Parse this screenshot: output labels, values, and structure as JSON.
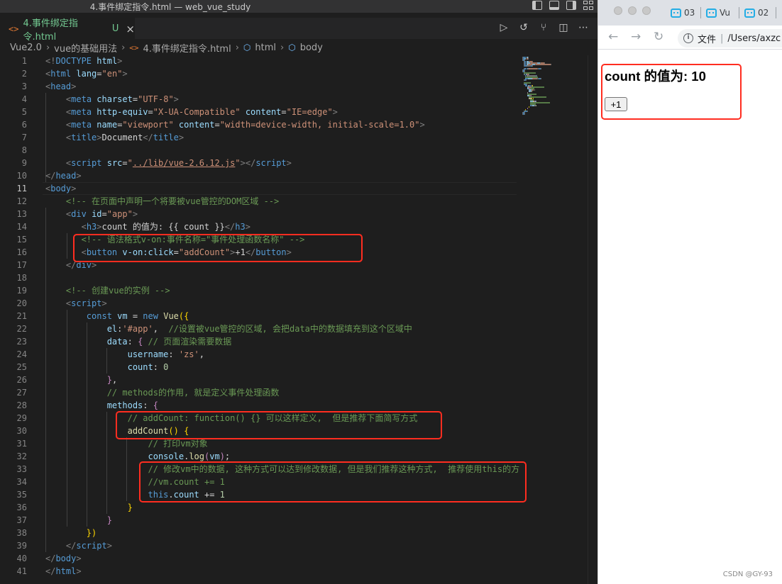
{
  "titlebar": {
    "title": "4.事件绑定指令.html — web_vue_study"
  },
  "tab": {
    "icon": "<>",
    "label": "4.事件绑定指令.html",
    "status": "U",
    "close": "×"
  },
  "breadcrumb": [
    "Vue2.0",
    "vue的基础用法",
    "4.事件绑定指令.html",
    "html",
    "body"
  ],
  "editor": {
    "current_line": 11,
    "lines": [
      {
        "n": 1,
        "code": [
          [
            "p",
            "<!"
          ],
          [
            "t",
            "DOCTYPE"
          ],
          [
            "w",
            " "
          ],
          [
            "a",
            "html"
          ],
          [
            "p",
            ">"
          ]
        ]
      },
      {
        "n": 2,
        "code": [
          [
            "p",
            "<"
          ],
          [
            "t",
            "html"
          ],
          [
            "w",
            " "
          ],
          [
            "a",
            "lang"
          ],
          [
            "w",
            "="
          ],
          [
            "s",
            "\"en\""
          ],
          [
            "p",
            ">"
          ]
        ]
      },
      {
        "n": 3,
        "code": [
          [
            "p",
            "<"
          ],
          [
            "t",
            "head"
          ],
          [
            "p",
            ">"
          ]
        ]
      },
      {
        "n": 4,
        "code": [
          [
            "w",
            "    "
          ],
          [
            "p",
            "<"
          ],
          [
            "t",
            "meta"
          ],
          [
            "w",
            " "
          ],
          [
            "a",
            "charset"
          ],
          [
            "w",
            "="
          ],
          [
            "s",
            "\"UTF-8\""
          ],
          [
            "p",
            ">"
          ]
        ]
      },
      {
        "n": 5,
        "code": [
          [
            "w",
            "    "
          ],
          [
            "p",
            "<"
          ],
          [
            "t",
            "meta"
          ],
          [
            "w",
            " "
          ],
          [
            "a",
            "http-equiv"
          ],
          [
            "w",
            "="
          ],
          [
            "s",
            "\"X-UA-Compatible\""
          ],
          [
            "w",
            " "
          ],
          [
            "a",
            "content"
          ],
          [
            "w",
            "="
          ],
          [
            "s",
            "\"IE=edge\""
          ],
          [
            "p",
            ">"
          ]
        ]
      },
      {
        "n": 6,
        "code": [
          [
            "w",
            "    "
          ],
          [
            "p",
            "<"
          ],
          [
            "t",
            "meta"
          ],
          [
            "w",
            " "
          ],
          [
            "a",
            "name"
          ],
          [
            "w",
            "="
          ],
          [
            "s",
            "\"viewport\""
          ],
          [
            "w",
            " "
          ],
          [
            "a",
            "content"
          ],
          [
            "w",
            "="
          ],
          [
            "s",
            "\"width=device-width, initial-scale=1.0\""
          ],
          [
            "p",
            ">"
          ]
        ]
      },
      {
        "n": 7,
        "code": [
          [
            "w",
            "    "
          ],
          [
            "p",
            "<"
          ],
          [
            "t",
            "title"
          ],
          [
            "p",
            ">"
          ],
          [
            "w",
            "Document"
          ],
          [
            "p",
            "</"
          ],
          [
            "t",
            "title"
          ],
          [
            "p",
            ">"
          ]
        ]
      },
      {
        "n": 8,
        "code": []
      },
      {
        "n": 9,
        "code": [
          [
            "w",
            "    "
          ],
          [
            "p",
            "<"
          ],
          [
            "t",
            "script"
          ],
          [
            "w",
            " "
          ],
          [
            "a",
            "src"
          ],
          [
            "w",
            "="
          ],
          [
            "s",
            "\""
          ],
          [
            "su",
            "../lib/vue-2.6.12.js"
          ],
          [
            "s",
            "\""
          ],
          [
            "p",
            "></"
          ],
          [
            "t",
            "script"
          ],
          [
            "p",
            ">"
          ]
        ]
      },
      {
        "n": 10,
        "code": [
          [
            "p",
            "</"
          ],
          [
            "t",
            "head"
          ],
          [
            "p",
            ">"
          ]
        ]
      },
      {
        "n": 11,
        "code": [
          [
            "p",
            "<"
          ],
          [
            "t",
            "body"
          ],
          [
            "p",
            ">"
          ]
        ]
      },
      {
        "n": 12,
        "code": [
          [
            "w",
            "    "
          ],
          [
            "c",
            "<!-- 在页面中声明一个将要被vue管控的DOM区域 -->"
          ]
        ]
      },
      {
        "n": 13,
        "code": [
          [
            "w",
            "    "
          ],
          [
            "p",
            "<"
          ],
          [
            "t",
            "div"
          ],
          [
            "w",
            " "
          ],
          [
            "a",
            "id"
          ],
          [
            "w",
            "="
          ],
          [
            "s",
            "\"app\""
          ],
          [
            "p",
            ">"
          ]
        ]
      },
      {
        "n": 14,
        "code": [
          [
            "w",
            "       "
          ],
          [
            "p",
            "<"
          ],
          [
            "t",
            "h3"
          ],
          [
            "p",
            ">"
          ],
          [
            "w",
            "count 的值为: {{ count }}"
          ],
          [
            "p",
            "</"
          ],
          [
            "t",
            "h3"
          ],
          [
            "p",
            ">"
          ]
        ]
      },
      {
        "n": 15,
        "code": [
          [
            "w",
            "       "
          ],
          [
            "c",
            "<!-- 语法格式v-on:事件名称=\"事件处理函数名称\" -->"
          ]
        ]
      },
      {
        "n": 16,
        "code": [
          [
            "w",
            "       "
          ],
          [
            "p",
            "<"
          ],
          [
            "t",
            "button"
          ],
          [
            "w",
            " "
          ],
          [
            "a",
            "v-on:click"
          ],
          [
            "w",
            "="
          ],
          [
            "s",
            "\"addCount\""
          ],
          [
            "p",
            ">"
          ],
          [
            "w",
            "+1"
          ],
          [
            "p",
            "</"
          ],
          [
            "t",
            "button"
          ],
          [
            "p",
            ">"
          ]
        ]
      },
      {
        "n": 17,
        "code": [
          [
            "w",
            "    "
          ],
          [
            "p",
            "</"
          ],
          [
            "t",
            "div"
          ],
          [
            "p",
            ">"
          ]
        ]
      },
      {
        "n": 18,
        "code": []
      },
      {
        "n": 19,
        "code": [
          [
            "w",
            "    "
          ],
          [
            "c",
            "<!-- 创建vue的实例 -->"
          ]
        ]
      },
      {
        "n": 20,
        "code": [
          [
            "w",
            "    "
          ],
          [
            "p",
            "<"
          ],
          [
            "t",
            "script"
          ],
          [
            "p",
            ">"
          ]
        ]
      },
      {
        "n": 21,
        "code": [
          [
            "w",
            "        "
          ],
          [
            "k",
            "const"
          ],
          [
            "w",
            " "
          ],
          [
            "v",
            "vm"
          ],
          [
            "w",
            " = "
          ],
          [
            "k",
            "new"
          ],
          [
            "w",
            " "
          ],
          [
            "f",
            "Vue"
          ],
          [
            "y",
            "({"
          ]
        ]
      },
      {
        "n": 22,
        "code": [
          [
            "w",
            "            "
          ],
          [
            "v",
            "el"
          ],
          [
            "w",
            ":"
          ],
          [
            "s",
            "'#app'"
          ],
          [
            "w",
            ",  "
          ],
          [
            "c",
            "//设置被vue管控的区域, 会把data中的数据填充到这个区域中"
          ]
        ]
      },
      {
        "n": 23,
        "code": [
          [
            "w",
            "            "
          ],
          [
            "v",
            "data"
          ],
          [
            "w",
            ": "
          ],
          [
            "m",
            "{"
          ],
          [
            "w",
            " "
          ],
          [
            "c",
            "// 页面渲染需要数据"
          ]
        ]
      },
      {
        "n": 24,
        "code": [
          [
            "w",
            "                "
          ],
          [
            "v",
            "username"
          ],
          [
            "w",
            ": "
          ],
          [
            "s",
            "'zs'"
          ],
          [
            "w",
            ","
          ]
        ]
      },
      {
        "n": 25,
        "code": [
          [
            "w",
            "                "
          ],
          [
            "v",
            "count"
          ],
          [
            "w",
            ": "
          ],
          [
            "n",
            "0"
          ]
        ]
      },
      {
        "n": 26,
        "code": [
          [
            "w",
            "            "
          ],
          [
            "m",
            "}"
          ],
          [
            "w",
            ","
          ]
        ]
      },
      {
        "n": 27,
        "code": [
          [
            "w",
            "            "
          ],
          [
            "c",
            "// methods的作用, 就是定义事件处理函数"
          ]
        ]
      },
      {
        "n": 28,
        "code": [
          [
            "w",
            "            "
          ],
          [
            "v",
            "methods"
          ],
          [
            "w",
            ": "
          ],
          [
            "m",
            "{"
          ]
        ]
      },
      {
        "n": 29,
        "code": [
          [
            "w",
            "                "
          ],
          [
            "c",
            "// addCount: function() {} 可以这样定义,  但是推荐下面简写方式"
          ]
        ]
      },
      {
        "n": 30,
        "code": [
          [
            "w",
            "                "
          ],
          [
            "f",
            "addCount"
          ],
          [
            "y",
            "()"
          ],
          [
            "w",
            " "
          ],
          [
            "y",
            "{"
          ]
        ]
      },
      {
        "n": 31,
        "code": [
          [
            "w",
            "                    "
          ],
          [
            "c",
            "// 打印vm对象"
          ]
        ]
      },
      {
        "n": 32,
        "code": [
          [
            "w",
            "                    "
          ],
          [
            "v",
            "console"
          ],
          [
            "w",
            "."
          ],
          [
            "f",
            "log"
          ],
          [
            "m",
            "("
          ],
          [
            "v",
            "vm"
          ],
          [
            "m",
            ")"
          ],
          [
            "w",
            ";"
          ]
        ]
      },
      {
        "n": 33,
        "code": [
          [
            "w",
            "                    "
          ],
          [
            "c",
            "// 修改vm中的数据, 这种方式可以达到修改数据, 但是我们推荐这种方式,  推荐使用this的方"
          ]
        ]
      },
      {
        "n": 34,
        "code": [
          [
            "w",
            "                    "
          ],
          [
            "c",
            "//vm.count += 1"
          ]
        ]
      },
      {
        "n": 35,
        "code": [
          [
            "w",
            "                    "
          ],
          [
            "k",
            "this"
          ],
          [
            "w",
            "."
          ],
          [
            "v",
            "count"
          ],
          [
            "w",
            " += "
          ],
          [
            "n",
            "1"
          ]
        ]
      },
      {
        "n": 36,
        "code": [
          [
            "w",
            "                "
          ],
          [
            "y",
            "}"
          ]
        ]
      },
      {
        "n": 37,
        "code": [
          [
            "w",
            "            "
          ],
          [
            "m",
            "}"
          ]
        ]
      },
      {
        "n": 38,
        "code": [
          [
            "w",
            "        "
          ],
          [
            "y",
            "})"
          ]
        ]
      },
      {
        "n": 39,
        "code": [
          [
            "w",
            "    "
          ],
          [
            "p",
            "</"
          ],
          [
            "t",
            "script"
          ],
          [
            "p",
            ">"
          ]
        ]
      },
      {
        "n": 40,
        "code": [
          [
            "p",
            "</"
          ],
          [
            "t",
            "body"
          ],
          [
            "p",
            ">"
          ]
        ]
      },
      {
        "n": 41,
        "code": [
          [
            "p",
            "</"
          ],
          [
            "t",
            "html"
          ],
          [
            "p",
            ">"
          ]
        ]
      }
    ]
  },
  "browser": {
    "tabs": [
      {
        "label": "03"
      },
      {
        "label": "Vu"
      },
      {
        "label": "02"
      }
    ],
    "address_prefix": "文件",
    "address": "/Users/axzc",
    "heading": "count 的值为: 10",
    "button_label": "+1",
    "watermark": "CSDN @GY-93"
  },
  "colors": {
    "highlight_box": "#ff2d20",
    "editor_bg": "#1e1e1e",
    "untracked": "#73c991"
  }
}
